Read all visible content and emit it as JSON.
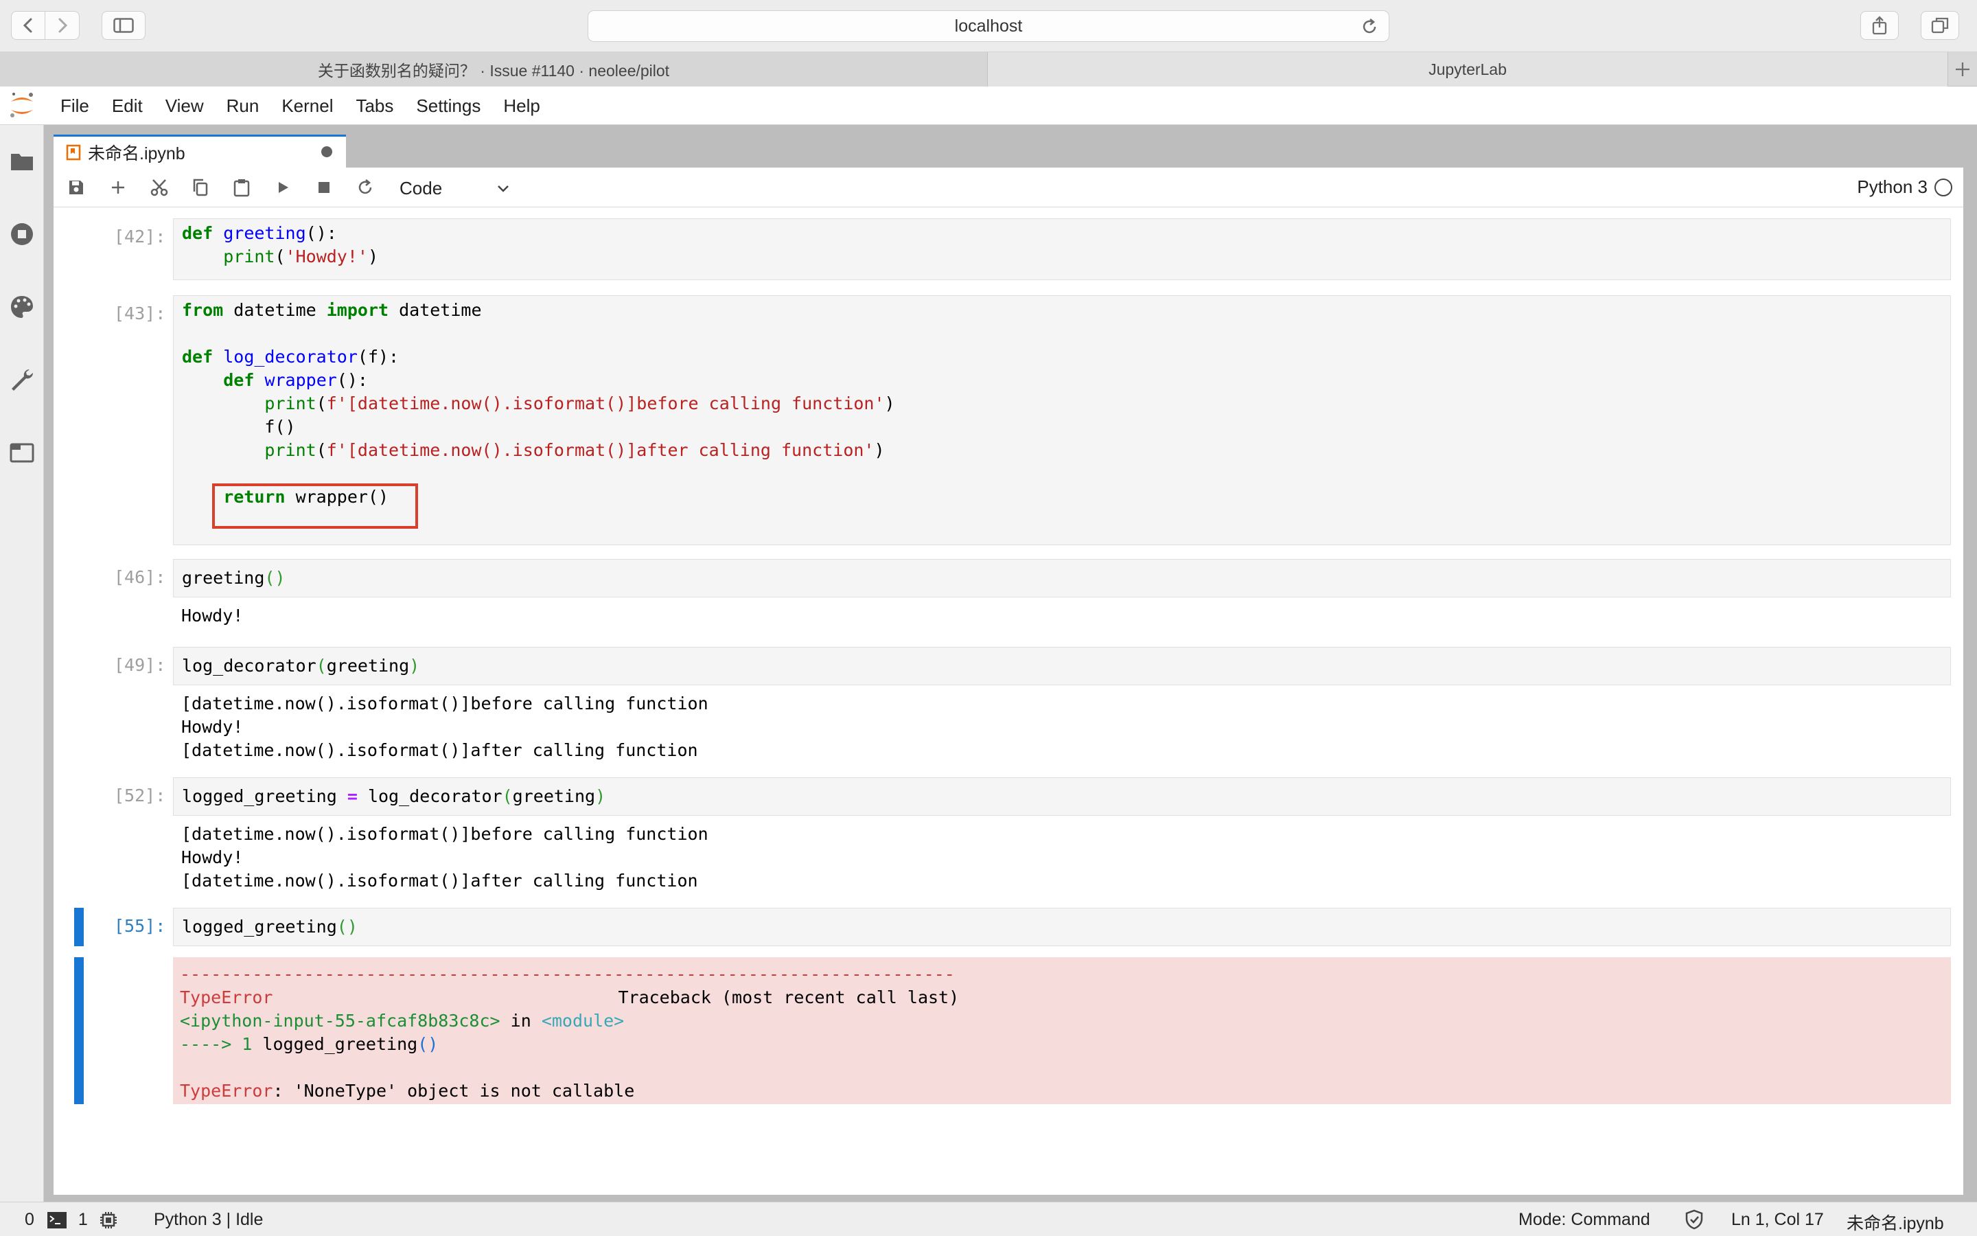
{
  "browser": {
    "address": "localhost",
    "tabs": [
      {
        "label": "关于函数别名的疑问？ · Issue #1140 · neolee/pilot"
      },
      {
        "label": "JupyterLab"
      }
    ]
  },
  "menubar": {
    "items": [
      "File",
      "Edit",
      "View",
      "Run",
      "Kernel",
      "Tabs",
      "Settings",
      "Help"
    ]
  },
  "doc_tab": {
    "label": "未命名.ipynb"
  },
  "toolbar": {
    "cell_type": "Code",
    "kernel": "Python 3"
  },
  "cells": {
    "c1": {
      "prompt": "[42]:"
    },
    "c2": {
      "prompt": "[43]:"
    },
    "c3": {
      "prompt": "[46]:",
      "output": "Howdy!"
    },
    "c4": {
      "prompt": "[49]:",
      "output": "[datetime.now().isoformat()]before calling function\nHowdy!\n[datetime.now().isoformat()]after calling function"
    },
    "c5": {
      "prompt": "[52]:",
      "output": "[datetime.now().isoformat()]before calling function\nHowdy!\n[datetime.now().isoformat()]after calling function"
    },
    "c6": {
      "prompt": "[55]:"
    }
  },
  "error": {
    "rule": "---------------------------------------------------------------------------",
    "type": "TypeError",
    "traceback": "Traceback (most recent call last)",
    "input": "<ipython-input-55-afcaf8b83c8c>",
    "in": " in ",
    "module": "<module>",
    "arrow": "----> 1 ",
    "line": "logged_greeting",
    "parens": "()",
    "message": ": 'NoneType' object is not callable"
  },
  "status": {
    "terminals": "0",
    "kernels": "1",
    "kernel_state": "Python 3 | Idle",
    "mode": "Mode: Command",
    "position": "Ln 1, Col 17",
    "file": "未命名.ipynb"
  },
  "colors": {
    "accent": "#1976d2",
    "error_bg": "#f7dcdc",
    "highlight": "#d9402b"
  }
}
